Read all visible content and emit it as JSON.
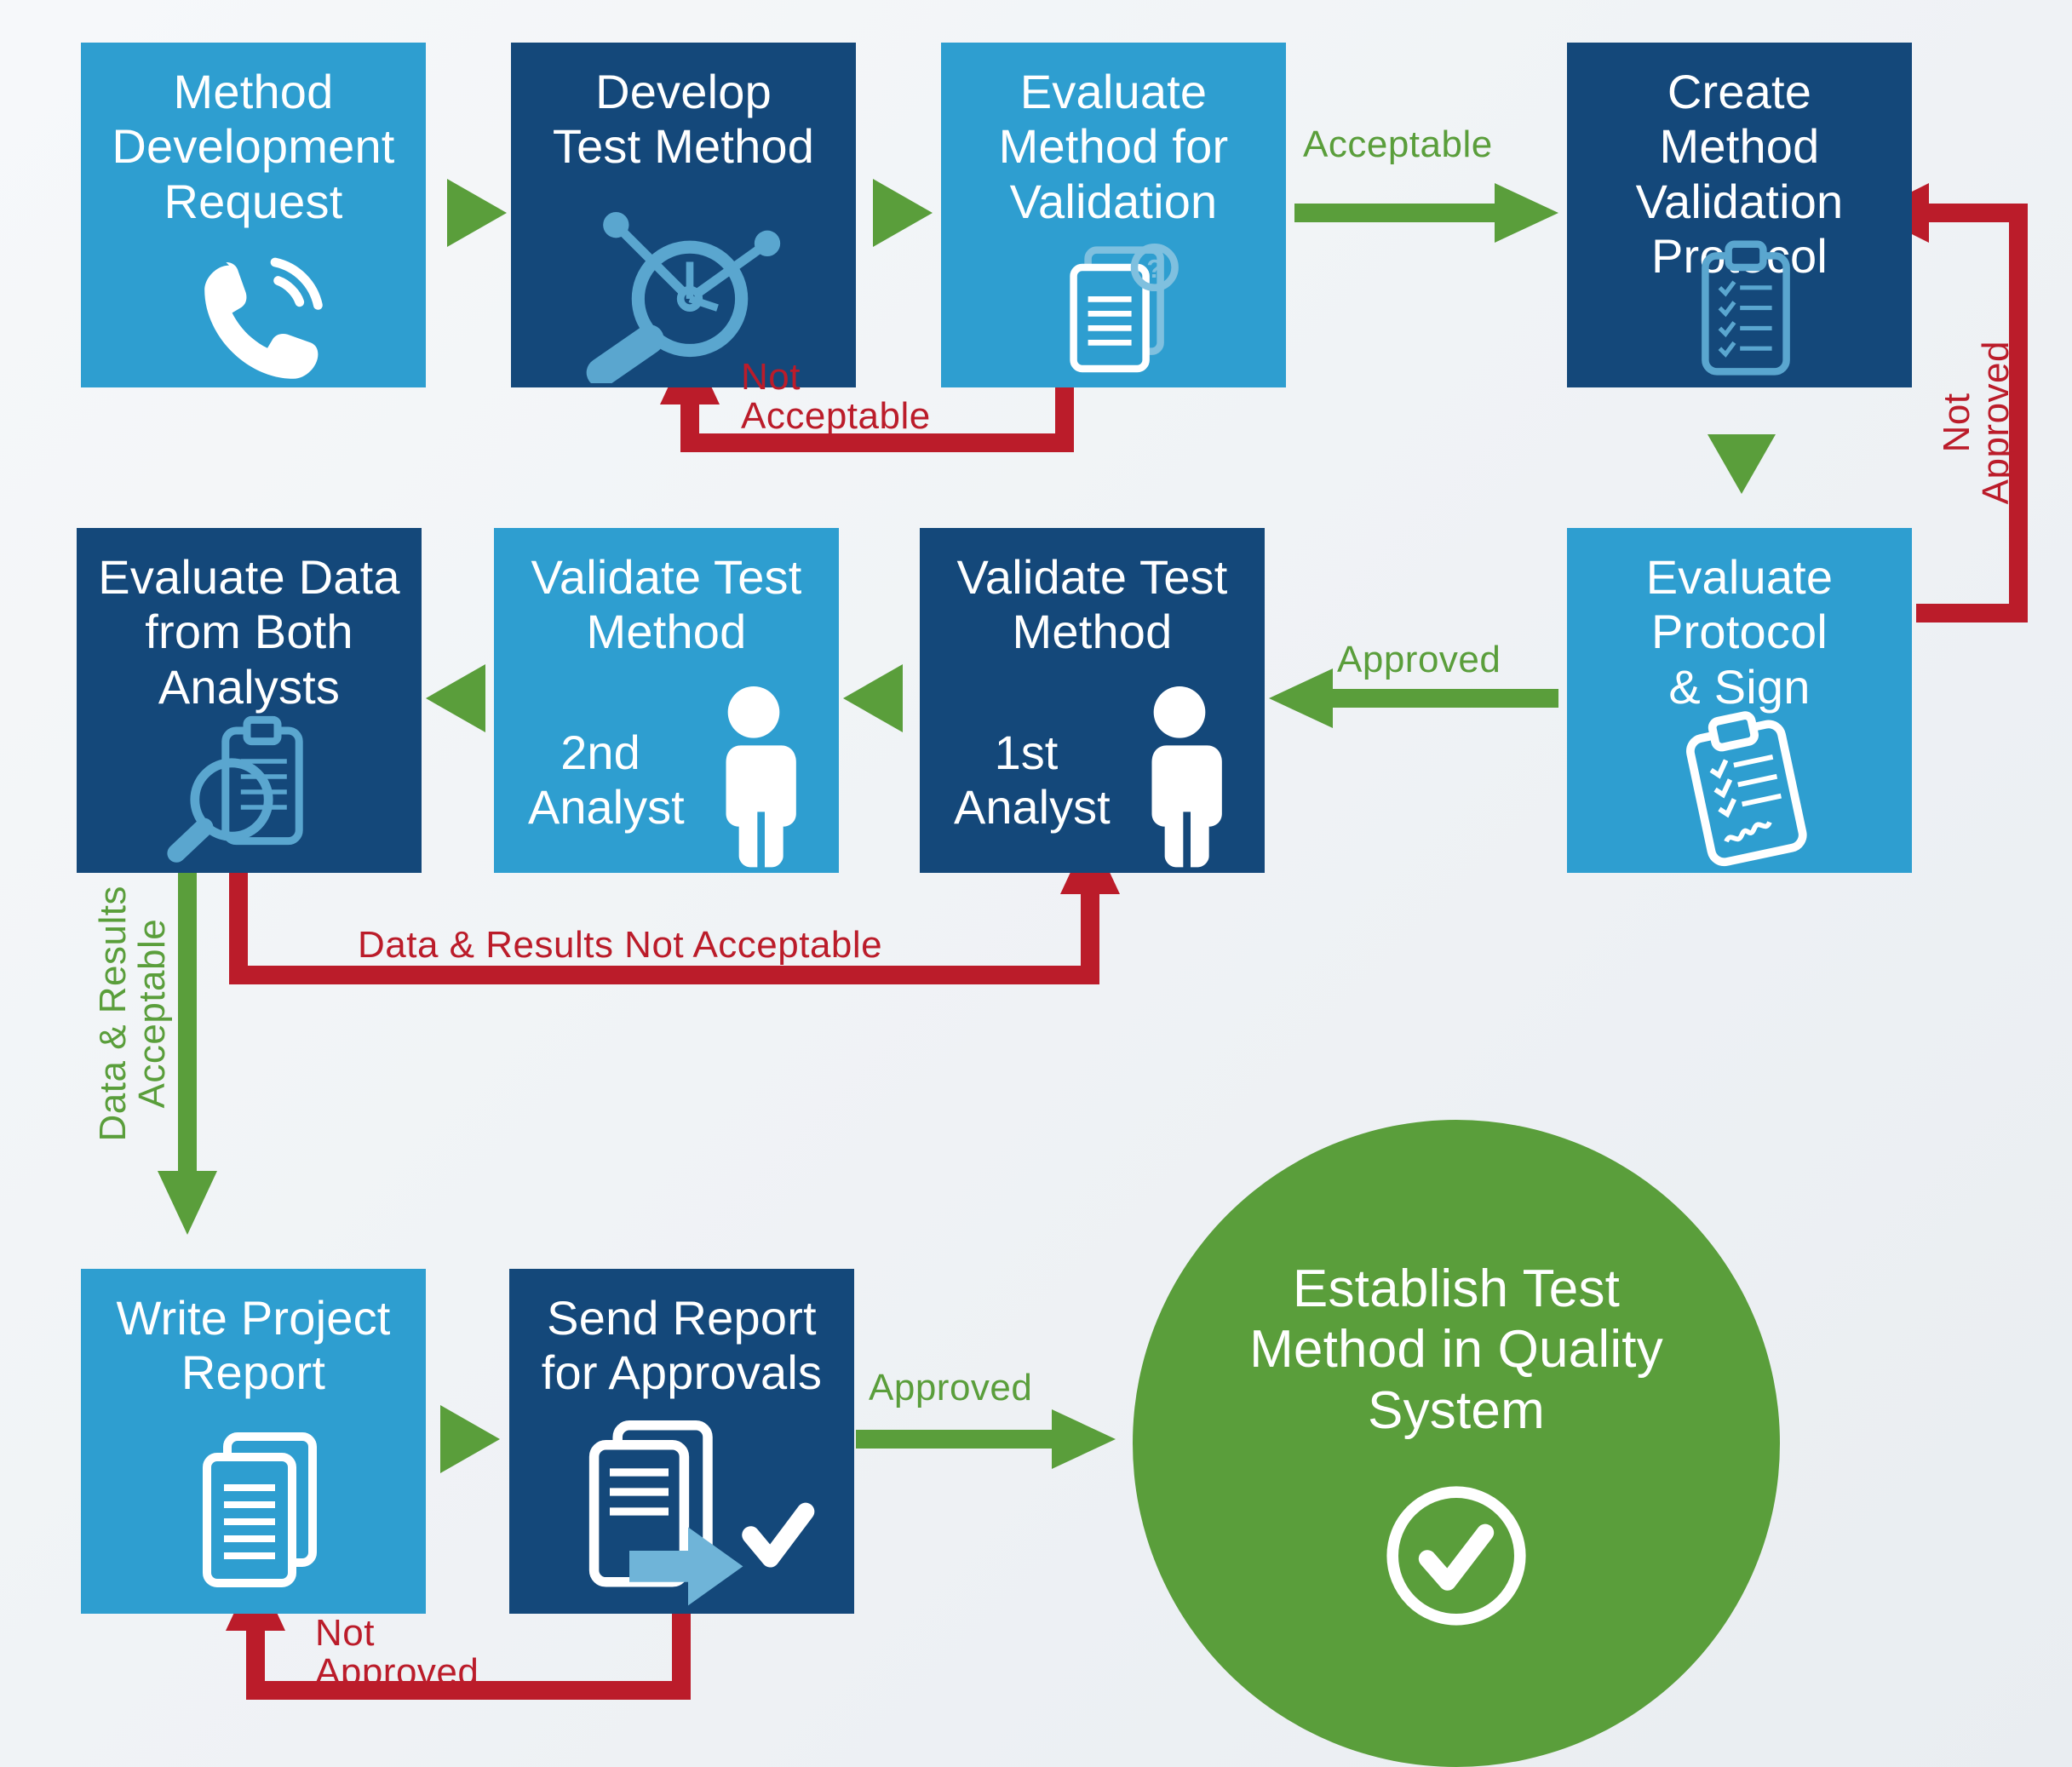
{
  "colors": {
    "light": "#2e9ed0",
    "dark": "#14487a",
    "green": "#5a9e3b",
    "red": "#bb1c2a"
  },
  "nodes": {
    "n1": {
      "line1": "Method",
      "line2": "Development",
      "line3": "Request"
    },
    "n2": {
      "line1": "Develop",
      "line2": "Test Method"
    },
    "n3": {
      "line1": "Evaluate",
      "line2": "Method for",
      "line3": "Validation"
    },
    "n4": {
      "line1": "Create Method",
      "line2": "Validation",
      "line3": "Protocol"
    },
    "n5": {
      "line1": "Evaluate",
      "line2": "Protocol",
      "line3": "& Sign"
    },
    "n6": {
      "line1": "Validate Test",
      "line2": "Method",
      "sub": "1st\nAnalyst"
    },
    "n7": {
      "line1": "Validate Test",
      "line2": "Method",
      "sub": "2nd\nAnalyst"
    },
    "n8": {
      "line1": "Evaluate Data",
      "line2": "from Both",
      "line3": "Analysts"
    },
    "n9": {
      "line1": "Write Project",
      "line2": "Report"
    },
    "n10": {
      "line1": "Send Report",
      "line2": "for Approvals"
    },
    "final": {
      "line1": "Establish Test",
      "line2": "Method in Quality",
      "line3": "System"
    }
  },
  "edges": {
    "acceptable": "Acceptable",
    "not_acceptable": {
      "l1": "Not",
      "l2": "Acceptable"
    },
    "approved": "Approved",
    "not_approved": {
      "l1": "Not",
      "l2": "Approved"
    },
    "data_not_accept": "Data & Results Not Acceptable",
    "data_accept": {
      "l1": "Data & Results",
      "l2": "Acceptable"
    },
    "approved2": "Approved",
    "not_approved2": {
      "l1": "Not",
      "l2": "Approved"
    }
  }
}
